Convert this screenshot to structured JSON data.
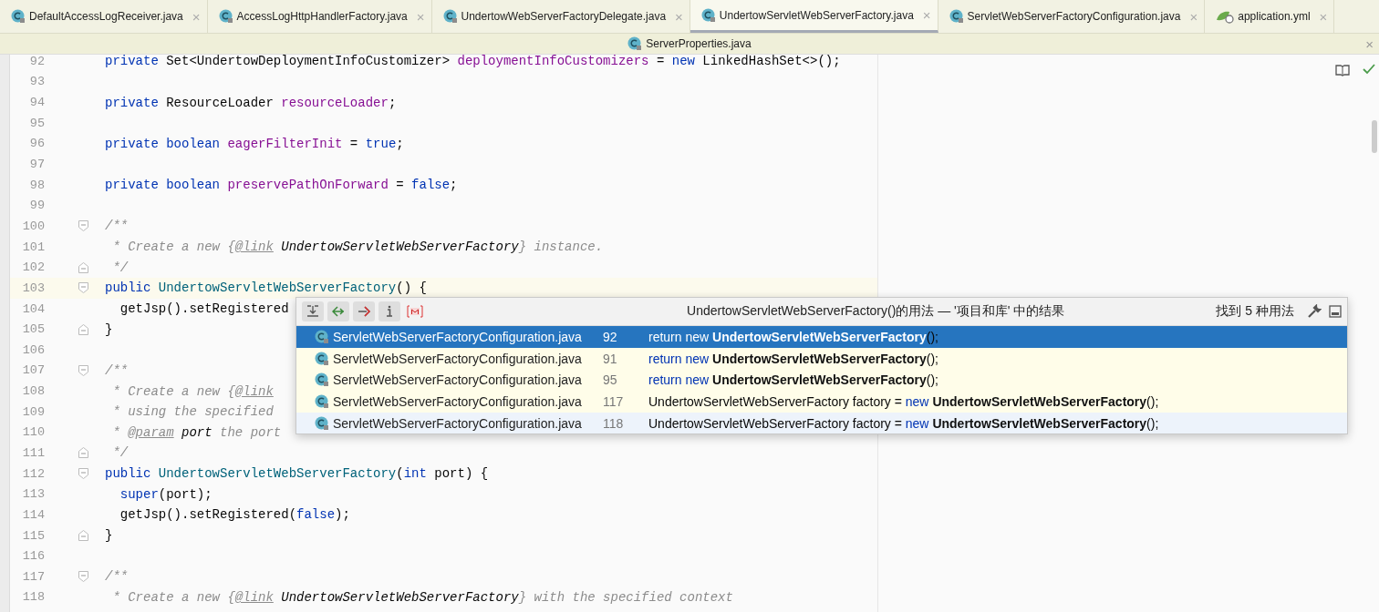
{
  "tabs": [
    {
      "label": "DefaultAccessLogReceiver.java",
      "kind": "class",
      "close": "×",
      "selected": false
    },
    {
      "label": "AccessLogHttpHandlerFactory.java",
      "kind": "class",
      "close": "×",
      "selected": false
    },
    {
      "label": "UndertowWebServerFactoryDelegate.java",
      "kind": "class",
      "close": "×",
      "selected": false
    },
    {
      "label": "UndertowServletWebServerFactory.java",
      "kind": "class",
      "close": "×",
      "selected": true
    },
    {
      "label": "ServletWebServerFactoryConfiguration.java",
      "kind": "class",
      "close": "×",
      "selected": false
    },
    {
      "label": "application.yml",
      "kind": "yaml",
      "close": "×",
      "selected": false
    }
  ],
  "second_row_tabs": [
    {
      "label": "ServerProperties.java",
      "kind": "class",
      "close": "×"
    }
  ],
  "editor": {
    "lines": [
      {
        "number": "92",
        "kind": "code",
        "current": false,
        "tokens": [
          {
            "kind": "kw",
            "text": "private "
          },
          {
            "kind": "plain",
            "text": "Set<UndertowDeploymentInfoCustomizer> "
          },
          {
            "kind": "field",
            "text": "deploymentInfoCustomizers"
          },
          {
            "kind": "plain",
            "text": " = "
          },
          {
            "kind": "kw",
            "text": "new "
          },
          {
            "kind": "plain",
            "text": "LinkedHashSet<>();"
          }
        ]
      },
      {
        "number": "93",
        "kind": "code",
        "current": false
      },
      {
        "number": "94",
        "kind": "code",
        "current": false,
        "tokens": [
          {
            "kind": "kw",
            "text": "private "
          },
          {
            "kind": "plain",
            "text": "ResourceLoader "
          },
          {
            "kind": "field",
            "text": "resourceLoader"
          },
          {
            "kind": "plain",
            "text": ";"
          }
        ]
      },
      {
        "number": "95",
        "kind": "code",
        "current": false
      },
      {
        "number": "96",
        "kind": "code",
        "current": false,
        "tokens": [
          {
            "kind": "kw",
            "text": "private boolean "
          },
          {
            "kind": "field",
            "text": "eagerFilterInit"
          },
          {
            "kind": "plain",
            "text": " = "
          },
          {
            "kind": "kw",
            "text": "true"
          },
          {
            "kind": "plain",
            "text": ";"
          }
        ]
      },
      {
        "number": "97",
        "kind": "code",
        "current": false
      },
      {
        "number": "98",
        "kind": "code",
        "current": false,
        "tokens": [
          {
            "kind": "kw",
            "text": "private boolean "
          },
          {
            "kind": "field",
            "text": "preservePathOnForward"
          },
          {
            "kind": "plain",
            "text": " = "
          },
          {
            "kind": "kw",
            "text": "false"
          },
          {
            "kind": "plain",
            "text": ";"
          }
        ]
      },
      {
        "number": "99",
        "kind": "code",
        "current": false
      },
      {
        "number": "100",
        "kind": "fold_start",
        "current": false,
        "tokens": [
          {
            "kind": "comment",
            "text": "/**"
          }
        ]
      },
      {
        "number": "101",
        "kind": "code",
        "current": false,
        "tokens": [
          {
            "kind": "comment",
            "text": " * Create a new {"
          },
          {
            "kind": "tag",
            "text": "@link"
          },
          {
            "kind": "docref",
            "text": " UndertowServletWebServerFactory"
          },
          {
            "kind": "comment",
            "text": "} instance."
          }
        ]
      },
      {
        "number": "102",
        "kind": "fold_end",
        "current": false,
        "tokens": [
          {
            "kind": "comment",
            "text": " */"
          }
        ]
      },
      {
        "number": "103",
        "kind": "fold_start",
        "current": true,
        "tokens": [
          {
            "kind": "kw",
            "text": "public "
          },
          {
            "kind": "method",
            "text": "UndertowServletWebServerFactory"
          },
          {
            "kind": "plain",
            "text": "() {"
          }
        ]
      },
      {
        "number": "104",
        "kind": "code",
        "current": false,
        "tokens": [
          {
            "kind": "plain",
            "text": "  getJsp().setRegistered"
          }
        ]
      },
      {
        "number": "105",
        "kind": "fold_end",
        "current": false,
        "tokens": [
          {
            "kind": "plain",
            "text": "}"
          }
        ]
      },
      {
        "number": "106",
        "kind": "code",
        "current": false
      },
      {
        "number": "107",
        "kind": "fold_start",
        "current": false,
        "tokens": [
          {
            "kind": "comment",
            "text": "/**"
          }
        ]
      },
      {
        "number": "108",
        "kind": "code",
        "current": false,
        "tokens": [
          {
            "kind": "comment",
            "text": " * Create a new {"
          },
          {
            "kind": "tag",
            "text": "@link"
          }
        ]
      },
      {
        "number": "109",
        "kind": "code",
        "current": false,
        "tokens": [
          {
            "kind": "comment",
            "text": " * using the specified"
          }
        ]
      },
      {
        "number": "110",
        "kind": "code",
        "current": false,
        "tokens": [
          {
            "kind": "comment",
            "text": " * "
          },
          {
            "kind": "tag",
            "text": "@param"
          },
          {
            "kind": "docref",
            "text": " port"
          },
          {
            "kind": "comment",
            "text": " the port"
          }
        ]
      },
      {
        "number": "111",
        "kind": "fold_end",
        "current": false,
        "tokens": [
          {
            "kind": "comment",
            "text": " */"
          }
        ]
      },
      {
        "number": "112",
        "kind": "fold_start",
        "current": false,
        "tokens": [
          {
            "kind": "kw",
            "text": "public "
          },
          {
            "kind": "method",
            "text": "UndertowServletWebServerFactory"
          },
          {
            "kind": "plain",
            "text": "("
          },
          {
            "kind": "kw",
            "text": "int "
          },
          {
            "kind": "plain",
            "text": "port) {"
          }
        ]
      },
      {
        "number": "113",
        "kind": "code",
        "current": false,
        "tokens": [
          {
            "kind": "kw",
            "text": "  super"
          },
          {
            "kind": "plain",
            "text": "(port);"
          }
        ]
      },
      {
        "number": "114",
        "kind": "code",
        "current": false,
        "tokens": [
          {
            "kind": "plain",
            "text": "  getJsp().setRegistered("
          },
          {
            "kind": "kw",
            "text": "false"
          },
          {
            "kind": "plain",
            "text": ");"
          }
        ]
      },
      {
        "number": "115",
        "kind": "fold_end",
        "current": false,
        "tokens": [
          {
            "kind": "plain",
            "text": "}"
          }
        ]
      },
      {
        "number": "116",
        "kind": "code",
        "current": false
      },
      {
        "number": "117",
        "kind": "fold_start",
        "current": false,
        "tokens": [
          {
            "kind": "comment",
            "text": "/**"
          }
        ]
      },
      {
        "number": "118",
        "kind": "code",
        "current": false,
        "tokens": [
          {
            "kind": "comment",
            "text": " * Create a new {"
          },
          {
            "kind": "tag",
            "text": "@link"
          },
          {
            "kind": "docref",
            "text": " UndertowServletWebServerFactory"
          },
          {
            "kind": "comment",
            "text": "} with the specified context"
          }
        ]
      }
    ]
  },
  "usages_popup": {
    "title": "UndertowServletWebServerFactory()的用法 — '项目和库' 中的结果",
    "count": "找到 5 种用法",
    "toolbar": [
      {
        "kind": "merge"
      },
      {
        "kind": "next"
      },
      {
        "kind": "prev"
      },
      {
        "kind": "info"
      },
      {
        "kind": "module"
      }
    ],
    "rows": [
      {
        "file": "ServletWebServerFactoryConfiguration.java",
        "line": "92",
        "selected": true,
        "hovered": false,
        "code": [
          {
            "kind": "kw",
            "text": "return new "
          },
          {
            "kind": "match",
            "text": "UndertowServletWebServerFactory"
          },
          {
            "kind": "plain",
            "text": "();"
          }
        ]
      },
      {
        "file": "ServletWebServerFactoryConfiguration.java",
        "line": "91",
        "selected": false,
        "hovered": false,
        "code": [
          {
            "kind": "kw",
            "text": "return new "
          },
          {
            "kind": "match",
            "text": "UndertowServletWebServerFactory"
          },
          {
            "kind": "plain",
            "text": "();"
          }
        ]
      },
      {
        "file": "ServletWebServerFactoryConfiguration.java",
        "line": "95",
        "selected": false,
        "hovered": false,
        "code": [
          {
            "kind": "kw",
            "text": "return new "
          },
          {
            "kind": "match",
            "text": "UndertowServletWebServerFactory"
          },
          {
            "kind": "plain",
            "text": "();"
          }
        ]
      },
      {
        "file": "ServletWebServerFactoryConfiguration.java",
        "line": "117",
        "selected": false,
        "hovered": false,
        "code": [
          {
            "kind": "plain",
            "text": "UndertowServletWebServerFactory factory = "
          },
          {
            "kind": "kw",
            "text": "new "
          },
          {
            "kind": "match",
            "text": "UndertowServletWebServerFactory"
          },
          {
            "kind": "plain",
            "text": "();"
          }
        ]
      },
      {
        "file": "ServletWebServerFactoryConfiguration.java",
        "line": "118",
        "selected": false,
        "hovered": true,
        "code": [
          {
            "kind": "plain",
            "text": "UndertowServletWebServerFactory factory = "
          },
          {
            "kind": "kw",
            "text": "new "
          },
          {
            "kind": "match",
            "text": "UndertowServletWebServerFactory"
          },
          {
            "kind": "plain",
            "text": "();"
          }
        ]
      }
    ]
  }
}
